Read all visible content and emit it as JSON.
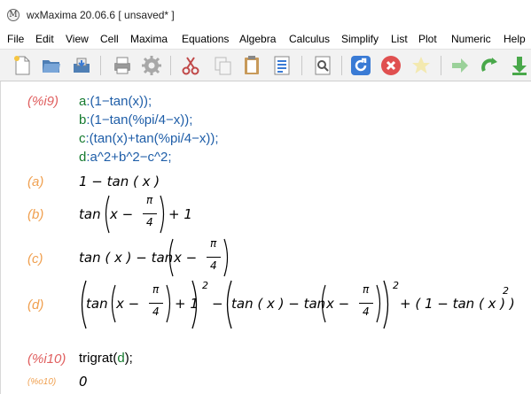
{
  "window": {
    "title": "wxMaxima 20.06.6 [ unsaved* ]",
    "icon": "wxmaxima-logo-icon"
  },
  "menubar": {
    "items": [
      "File",
      "Edit",
      "View",
      "Cell",
      "Maxima",
      "Equations",
      "Algebra",
      "Calculus",
      "Simplify",
      "List",
      "Plot",
      "Numeric",
      "Help"
    ]
  },
  "toolbar": {
    "buttons": [
      "new-document-icon",
      "open-folder-icon",
      "save-icon",
      "print-icon",
      "settings-gear-icon",
      "cut-icon",
      "copy-icon",
      "paste-icon",
      "select-all-icon",
      "find-icon",
      "refresh-icon",
      "stop-icon",
      "star-icon",
      "step-forward-icon",
      "follow-icon",
      "evaluate-down-icon"
    ],
    "colors": {
      "refresh": "#3a7bd5",
      "stop": "#e05050",
      "forward": "#49a84a"
    }
  },
  "worksheet": {
    "input1": {
      "label": "(%i9)",
      "lines": [
        {
          "var": "a",
          "body": ":(1−tan(x));"
        },
        {
          "var": "b",
          "body": ":(1−tan(%pi/4−x));"
        },
        {
          "var": "c",
          "body": ":(tan(x)+tan(%pi/4−x));"
        },
        {
          "var": "d",
          "body": ":a^2+b^2−c^2;"
        }
      ]
    },
    "outputs": {
      "a": {
        "label": "(a)",
        "expr": "1 − tan ( x )"
      },
      "b": {
        "label": "(b)",
        "left": "tan",
        "inner": "x −",
        "num": "π",
        "den": "4",
        "tail": "+ 1"
      },
      "c": {
        "label": "(c)",
        "lead": "tan ( x ) − tan",
        "inner": "x −",
        "num": "π",
        "den": "4"
      },
      "d": {
        "label": "(d)",
        "t1": "tan",
        "inner1": "x −",
        "num": "π",
        "den": "4",
        "p1": "+ 1",
        "exp": "2",
        "minus": "−",
        "t2": "tan ( x ) − tan",
        "inner2": "x −",
        "tail": "+ ( 1 − tan ( x ) )"
      }
    },
    "input2": {
      "label": "(%i10)",
      "cmd": "trigrat(",
      "arg": "d",
      "close": ");"
    },
    "result": {
      "label": "(%o10)",
      "value": "0"
    }
  }
}
